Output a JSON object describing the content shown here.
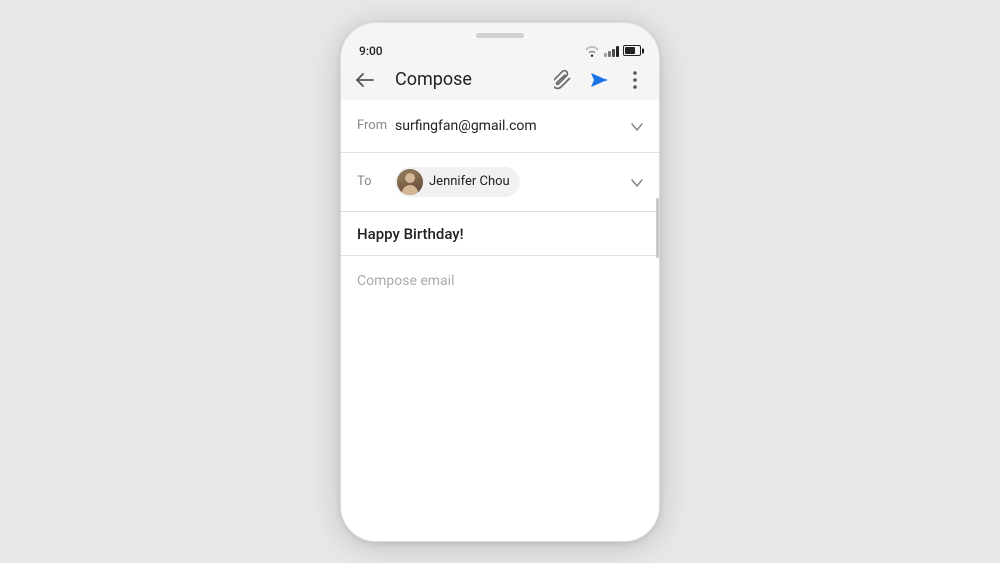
{
  "phone": {
    "status_bar": {
      "time": "9:00",
      "wifi": "wifi",
      "signal": "signal",
      "battery": "battery"
    },
    "app_bar": {
      "back_label": "back",
      "title": "Compose",
      "attach_label": "attach",
      "send_label": "send",
      "more_label": "more"
    },
    "from_field": {
      "label": "From",
      "value": "surfingfan@gmail.com"
    },
    "to_field": {
      "label": "To",
      "recipient": "Jennifer Chou"
    },
    "subject_field": {
      "value": "Happy Birthday!"
    },
    "body_field": {
      "placeholder": "Compose email"
    }
  }
}
